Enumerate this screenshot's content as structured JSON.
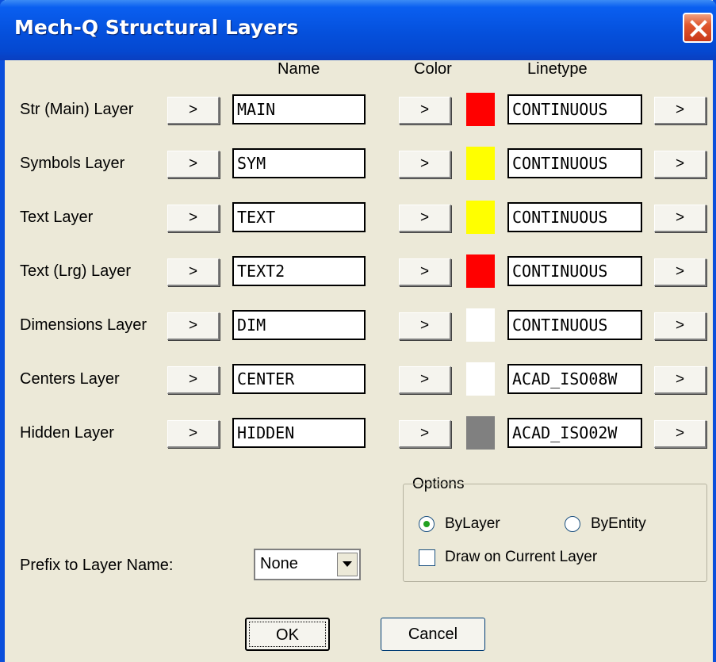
{
  "window": {
    "title": "Mech-Q Structural Layers"
  },
  "columns": {
    "name": "Name",
    "color": "Color",
    "linetype": "Linetype"
  },
  "button_glyph": ">",
  "rows": [
    {
      "label": "Str (Main) Layer",
      "name": "MAIN",
      "color": "#ff0000",
      "linetype": "CONTINUOUS"
    },
    {
      "label": "Symbols Layer",
      "name": "SYM",
      "color": "#ffff00",
      "linetype": "CONTINUOUS"
    },
    {
      "label": "Text Layer",
      "name": "TEXT",
      "color": "#ffff00",
      "linetype": "CONTINUOUS"
    },
    {
      "label": "Text (Lrg) Layer",
      "name": "TEXT2",
      "color": "#ff0000",
      "linetype": "CONTINUOUS"
    },
    {
      "label": "Dimensions Layer",
      "name": "DIM",
      "color": "#ffffff",
      "linetype": "CONTINUOUS"
    },
    {
      "label": "Centers Layer",
      "name": "CENTER",
      "color": "#ffffff",
      "linetype": "ACAD_ISO08W"
    },
    {
      "label": "Hidden Layer",
      "name": "HIDDEN",
      "color": "#808080",
      "linetype": "ACAD_ISO02W"
    }
  ],
  "options": {
    "title": "Options",
    "bylayer_label": "ByLayer",
    "byentity_label": "ByEntity",
    "selected": "ByLayer",
    "draw_current_label": "Draw on Current Layer",
    "draw_current_checked": false
  },
  "prefix": {
    "label": "Prefix to Layer Name:",
    "value": "None"
  },
  "buttons": {
    "ok": "OK",
    "cancel": "Cancel"
  }
}
